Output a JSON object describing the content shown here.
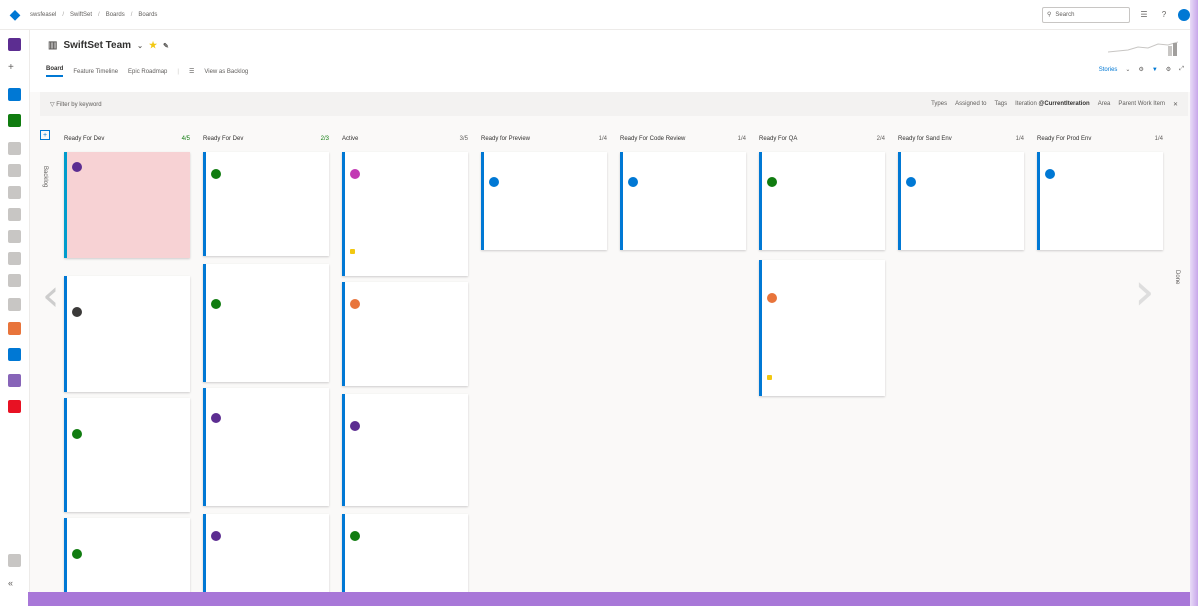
{
  "topbar": {
    "crumbs": [
      "swsfeasel",
      "SwiftSet",
      "Boards",
      "Boards"
    ],
    "search_placeholder": "Search"
  },
  "header": {
    "team_name": "SwiftSet Team",
    "tabs": [
      "Board",
      "Feature Timeline",
      "Epic Roadmap"
    ],
    "view_as_backlog": "View as Backlog",
    "actions": [
      "Stories"
    ]
  },
  "filterbar": {
    "filter_placeholder": "Filter by keyword",
    "filters": [
      "Types",
      "Assigned to",
      "Tags",
      "Iteration",
      "Area",
      "Parent Work Item"
    ],
    "iteration_value": "@CurrentIteration"
  },
  "board": {
    "new_label": "Backlog",
    "done_label": "Done",
    "columns": [
      {
        "name": "Ready For Dev",
        "count": "4/5"
      },
      {
        "name": "Ready For Dev",
        "count": "2/3"
      },
      {
        "name": "Active",
        "count": "3/5"
      },
      {
        "name": "Ready for Preview",
        "count": "1/4"
      },
      {
        "name": "Ready For Code Review",
        "count": "1/4"
      },
      {
        "name": "Ready For QA",
        "count": "2/4"
      },
      {
        "name": "Ready for Sand Env",
        "count": "1/4"
      },
      {
        "name": "Ready For Prod Env",
        "count": "1/4"
      }
    ]
  },
  "colors": {
    "accent": "#0078d4",
    "blocked_card": "#f7d2d4",
    "purple_bar": "#a877d8"
  }
}
